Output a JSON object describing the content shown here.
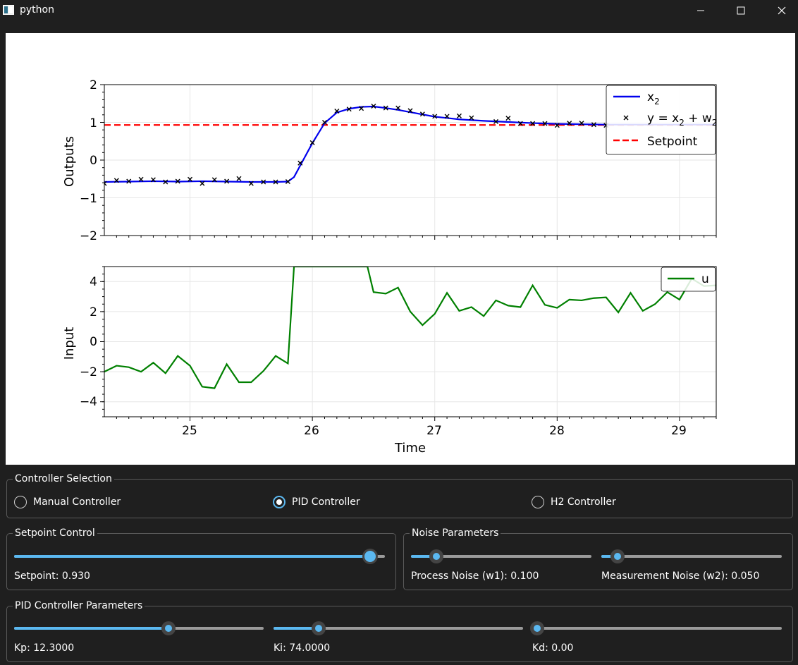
{
  "window": {
    "title": "python"
  },
  "plot": {
    "top": {
      "ylabel": "Outputs",
      "yticks": [
        "2",
        "1",
        "0",
        "−1",
        "−2"
      ],
      "legend": {
        "x2": "x",
        "x2_sub": "2",
        "y": "y = x",
        "y_sub1": "2",
        "y_mid": " + w",
        "y_sub2": "2",
        "setpoint": "Setpoint"
      }
    },
    "bottom": {
      "ylabel": "Input",
      "yticks": [
        "4",
        "2",
        "0",
        "−2",
        "−4"
      ],
      "legend": {
        "u": "u"
      }
    },
    "xticks": [
      "25",
      "26",
      "27",
      "28",
      "29"
    ],
    "xlabel": "Time"
  },
  "chart_data": [
    {
      "type": "line",
      "ylabel": "Outputs",
      "xlim": [
        24.3,
        29.3
      ],
      "ylim": [
        -2,
        2
      ],
      "grid": true,
      "legend_position": "top-right",
      "series": [
        {
          "name": "x2",
          "color": "#0000ee",
          "style": "solid",
          "x": [
            24.3,
            24.5,
            24.7,
            24.9,
            25.1,
            25.3,
            25.5,
            25.7,
            25.8,
            25.85,
            25.9,
            26.0,
            26.1,
            26.2,
            26.3,
            26.4,
            26.5,
            26.6,
            26.7,
            26.8,
            27.0,
            27.2,
            27.4,
            27.6,
            27.8,
            28.0,
            28.2,
            28.4,
            28.6,
            28.8,
            29.0,
            29.3
          ],
          "y": [
            -0.58,
            -0.57,
            -0.56,
            -0.57,
            -0.56,
            -0.57,
            -0.58,
            -0.58,
            -0.57,
            -0.45,
            -0.15,
            0.45,
            0.98,
            1.26,
            1.36,
            1.41,
            1.42,
            1.38,
            1.33,
            1.27,
            1.15,
            1.08,
            1.04,
            1.01,
            0.98,
            0.96,
            0.95,
            0.94,
            0.94,
            0.94,
            0.94,
            0.94
          ]
        },
        {
          "name": "y = x2 + w2",
          "color": "#000000",
          "style": "x-marker",
          "x": [
            24.3,
            24.4,
            24.5,
            24.6,
            24.7,
            24.8,
            24.9,
            25.0,
            25.1,
            25.2,
            25.3,
            25.4,
            25.5,
            25.6,
            25.7,
            25.8,
            25.9,
            26.0,
            26.1,
            26.2,
            26.3,
            26.4,
            26.5,
            26.6,
            26.7,
            26.8,
            26.9,
            27.0,
            27.1,
            27.2,
            27.3,
            27.5,
            27.6,
            27.7,
            27.8,
            27.9,
            28.0,
            28.1,
            28.2,
            28.3,
            28.4
          ],
          "y": [
            -0.62,
            -0.54,
            -0.56,
            -0.51,
            -0.52,
            -0.58,
            -0.56,
            -0.51,
            -0.62,
            -0.52,
            -0.56,
            -0.49,
            -0.62,
            -0.58,
            -0.58,
            -0.57,
            -0.08,
            0.46,
            1.0,
            1.3,
            1.35,
            1.37,
            1.43,
            1.38,
            1.38,
            1.31,
            1.22,
            1.16,
            1.16,
            1.17,
            1.12,
            1.02,
            1.11,
            0.97,
            0.97,
            0.97,
            0.92,
            0.98,
            0.98,
            0.94,
            0.92
          ]
        },
        {
          "name": "Setpoint",
          "color": "#ff0000",
          "style": "dashed",
          "x": [
            24.3,
            29.3
          ],
          "y": [
            0.93,
            0.93
          ]
        }
      ]
    },
    {
      "type": "line",
      "xlabel": "Time",
      "ylabel": "Input",
      "xlim": [
        24.3,
        29.3
      ],
      "ylim": [
        -5,
        5
      ],
      "grid": true,
      "legend_position": "top-right",
      "series": [
        {
          "name": "u",
          "color": "#008000",
          "style": "solid",
          "x": [
            24.3,
            24.4,
            24.5,
            24.6,
            24.7,
            24.8,
            24.9,
            25.0,
            25.1,
            25.2,
            25.3,
            25.4,
            25.5,
            25.6,
            25.7,
            25.8,
            25.85,
            26.45,
            26.5,
            26.6,
            26.7,
            26.8,
            26.9,
            27.0,
            27.1,
            27.2,
            27.3,
            27.4,
            27.5,
            27.6,
            27.7,
            27.8,
            27.9,
            28.0,
            28.1,
            28.2,
            28.3,
            28.4,
            28.5,
            28.6,
            28.7,
            28.8,
            28.9,
            29.0,
            29.1,
            29.2,
            29.3
          ],
          "y": [
            -2.0,
            -1.6,
            -1.7,
            -2.0,
            -1.4,
            -2.1,
            -0.95,
            -1.6,
            -3.0,
            -3.1,
            -1.5,
            -2.7,
            -2.7,
            -1.95,
            -0.95,
            -1.45,
            5.0,
            5.0,
            3.3,
            3.2,
            3.6,
            2.0,
            1.1,
            1.85,
            3.25,
            2.05,
            2.3,
            1.7,
            2.75,
            2.4,
            2.3,
            3.75,
            2.45,
            2.25,
            2.8,
            2.75,
            2.9,
            2.95,
            1.95,
            3.25,
            2.05,
            2.5,
            3.3,
            2.8,
            4.2,
            3.7,
            3.75
          ]
        }
      ]
    }
  ],
  "controller_selection": {
    "title": "Controller Selection",
    "options": [
      {
        "label": "Manual Controller",
        "checked": false
      },
      {
        "label": "PID Controller",
        "checked": true
      },
      {
        "label": "H2 Controller",
        "checked": false
      }
    ]
  },
  "setpoint_control": {
    "title": "Setpoint Control",
    "label": "Setpoint: 0.930",
    "fraction": 0.96
  },
  "noise": {
    "title": "Noise Parameters",
    "process_label": "Process Noise (w1): 0.100",
    "process_fraction": 0.14,
    "measurement_label": "Measurement Noise (w2): 0.050",
    "measurement_fraction": 0.09
  },
  "pid": {
    "title": "PID Controller Parameters",
    "kp_label": "Kp: 12.3000",
    "kp_fraction": 0.62,
    "ki_label": "Ki: 74.0000",
    "ki_fraction": 0.18,
    "kd_label": "Kd: 0.00",
    "kd_fraction": 0.02
  },
  "colors": {
    "accent": "#5bb8f0",
    "x2": "#0000ee",
    "setpoint": "#ff0000",
    "u": "#008000"
  }
}
